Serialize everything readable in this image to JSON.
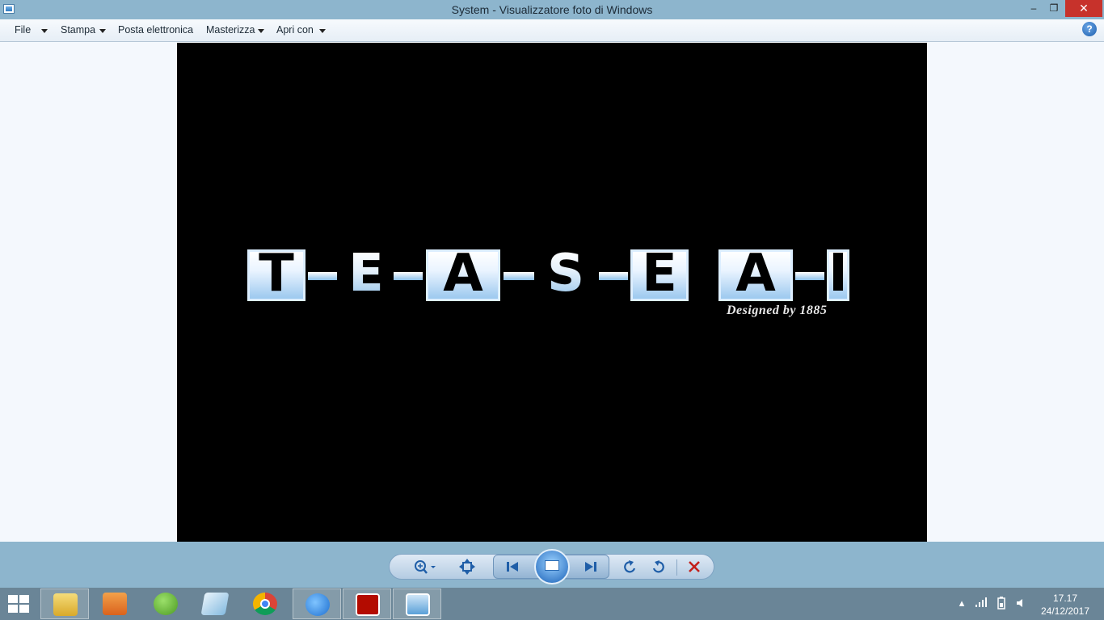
{
  "window": {
    "title": "System - Visualizzatore foto di Windows"
  },
  "title_controls": {
    "minimize": "–",
    "maximize": "❐",
    "close": "✕"
  },
  "menu": {
    "items": [
      {
        "label": "File",
        "has_dropdown": true
      },
      {
        "label": "Stampa",
        "has_dropdown": true
      },
      {
        "label": "Posta elettronica",
        "has_dropdown": false
      },
      {
        "label": "Masterizza",
        "has_dropdown": true
      },
      {
        "label": "Apri con",
        "has_dropdown": true
      }
    ],
    "help": "?"
  },
  "photo": {
    "logo_letters": [
      "T",
      "E",
      "A",
      "S",
      "E",
      "A",
      "I"
    ],
    "tagline": "Designed by 1885",
    "background": "#000000",
    "accent": "#8bbfe9"
  },
  "controls": {
    "zoom": "zoom-icon",
    "fit": "actual-size-icon",
    "previous": "previous-icon",
    "slideshow": "slideshow-icon",
    "next": "next-icon",
    "rotate_ccw": "rotate-counterclockwise-icon",
    "rotate_cw": "rotate-clockwise-icon",
    "delete": "delete-icon"
  },
  "taskbar": {
    "apps": [
      {
        "name": "File Explorer",
        "icon": "folder-icon",
        "color": "#e8c24a"
      },
      {
        "name": "Media player",
        "icon": "media-player-icon",
        "color": "#e07a2a"
      },
      {
        "name": "uTorrent",
        "icon": "utorrent-icon",
        "color": "#6fbf3a"
      },
      {
        "name": "Notepad",
        "icon": "notepad-icon",
        "color": "#8fbfe0"
      },
      {
        "name": "Google Chrome",
        "icon": "chrome-icon",
        "color": "#db4437"
      },
      {
        "name": "Internet Explorer",
        "icon": "ie-icon",
        "color": "#3a8ee6"
      },
      {
        "name": "Adobe Reader",
        "icon": "pdf-icon",
        "color": "#b30b00"
      },
      {
        "name": "Visualizzatore foto",
        "icon": "photo-viewer-icon",
        "color": "#5aa0d8"
      }
    ],
    "clock": {
      "time": "17.17",
      "date": "24/12/2017"
    }
  }
}
